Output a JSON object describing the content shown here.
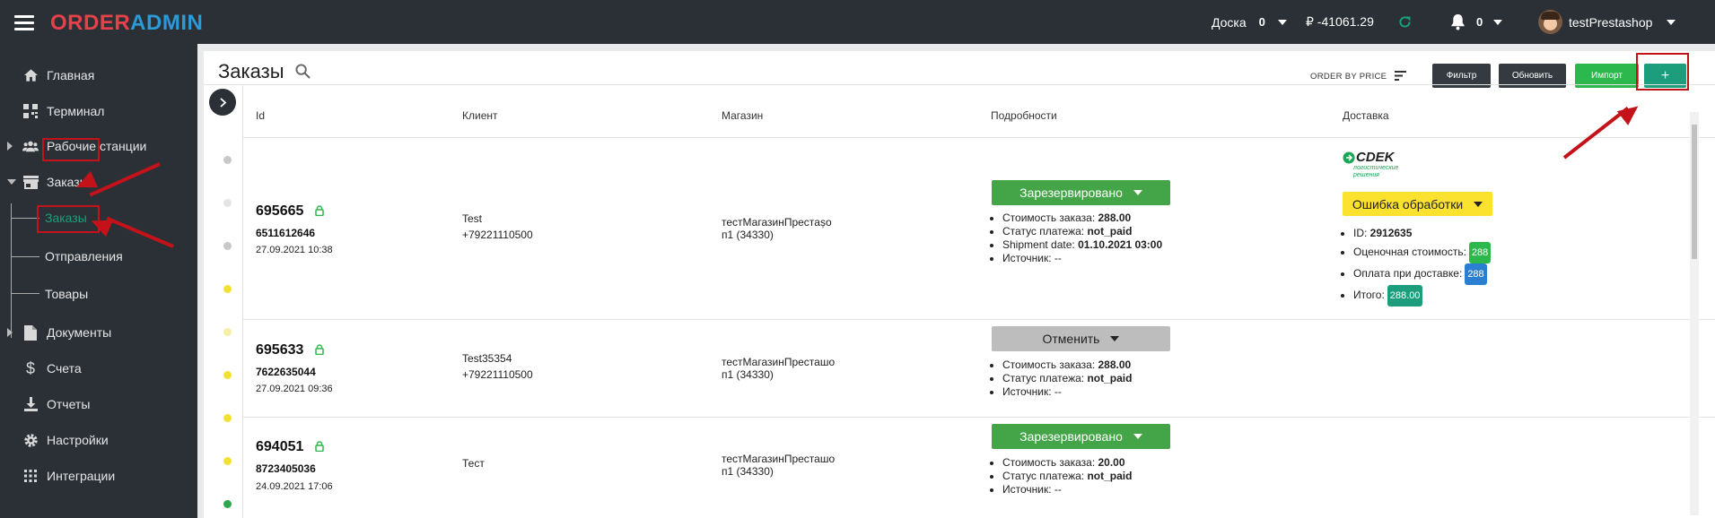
{
  "header": {
    "logo_part1": "ORDER",
    "logo_part2": "ADMIN",
    "board_label": "Доска",
    "board_count": "0",
    "balance": "₽ -41061.29",
    "notif_count": "0",
    "username": "testPrestashop"
  },
  "sidebar": {
    "items": [
      {
        "label": "Главная",
        "icon": "home-icon"
      },
      {
        "label": "Терминал",
        "icon": "qr-icon"
      },
      {
        "label": "Рабочие станции",
        "icon": "users-icon"
      },
      {
        "label": "Заказы",
        "icon": "store-icon"
      },
      {
        "label": "Документы",
        "icon": "document-icon"
      },
      {
        "label": "Счета",
        "icon": "dollar-icon"
      },
      {
        "label": "Отчеты",
        "icon": "download-icon"
      },
      {
        "label": "Настройки",
        "icon": "gear-icon"
      },
      {
        "label": "Интеграции",
        "icon": "grid-icon"
      }
    ],
    "sub_items": [
      "Заказы",
      "Отправления",
      "Товары"
    ]
  },
  "page": {
    "title": "Заказы",
    "order_by": "ORDER BY PRICE",
    "filter_btn": "Фильтр",
    "refresh_btn": "Обновить",
    "import_btn": "Импорт",
    "add_btn": "+"
  },
  "table": {
    "headers": [
      "Id",
      "Клиент",
      "Магазин",
      "Подробности",
      "Доставка"
    ],
    "rows": [
      {
        "id": "695665",
        "code": "6511612646",
        "date": "27.09.2021 10:38",
        "client_name": "Test",
        "client_phone": "+79221110500",
        "shop_line1": "тестМагазинПрестașо",
        "shop_line2": "п1 (34330)",
        "status": "Зарезервировано",
        "details": [
          {
            "k": "Стоимость заказа: ",
            "v": "288.00"
          },
          {
            "k": "Статус платежа: ",
            "v": "not_paid"
          },
          {
            "k": "Shipment date: ",
            "v": "01.10.2021 03:00"
          },
          {
            "k": "Источник: ",
            "v": "--"
          }
        ],
        "delivery": {
          "carrier": "СDEK",
          "carrier_sub1": "логистические",
          "carrier_sub2": "решения",
          "status": "Ошибка обработки",
          "id_label": "ID: ",
          "id_value": "2912635",
          "est_label": "Оценочная стоимость:",
          "est_value": "288",
          "cod_label": "Оплата при доставке:",
          "cod_value": "288",
          "total_label": "Итого:",
          "total_value": "288.00"
        }
      },
      {
        "id": "695633",
        "code": "7622635044",
        "date": "27.09.2021 09:36",
        "client_name": "Test35354",
        "client_phone": "+79221110500",
        "shop_line1": "тестМагазинПресташо",
        "shop_line2": "п1 (34330)",
        "status": "Отменить",
        "details": [
          {
            "k": "Стоимость заказа: ",
            "v": "288.00"
          },
          {
            "k": "Статус платежа: ",
            "v": "not_paid"
          },
          {
            "k": "Источник: ",
            "v": "--"
          }
        ]
      },
      {
        "id": "694051",
        "code": "8723405036",
        "date": "24.09.2021 17:06",
        "client_name": "Тест",
        "client_phone": "",
        "shop_line1": "тестМагазинПресташо",
        "shop_line2": "п1 (34330)",
        "status": "Зарезервировано",
        "details": [
          {
            "k": "Стоимость заказа: ",
            "v": "20.00"
          },
          {
            "k": "Статус платежа: ",
            "v": "not_paid"
          },
          {
            "k": "Источник: ",
            "v": "--"
          }
        ]
      }
    ]
  },
  "colors": {
    "green": "#43a547",
    "teal": "#1c9e7d",
    "dark": "#343a40",
    "yellow": "#fbe22f",
    "gray": "#bdbdbd"
  }
}
